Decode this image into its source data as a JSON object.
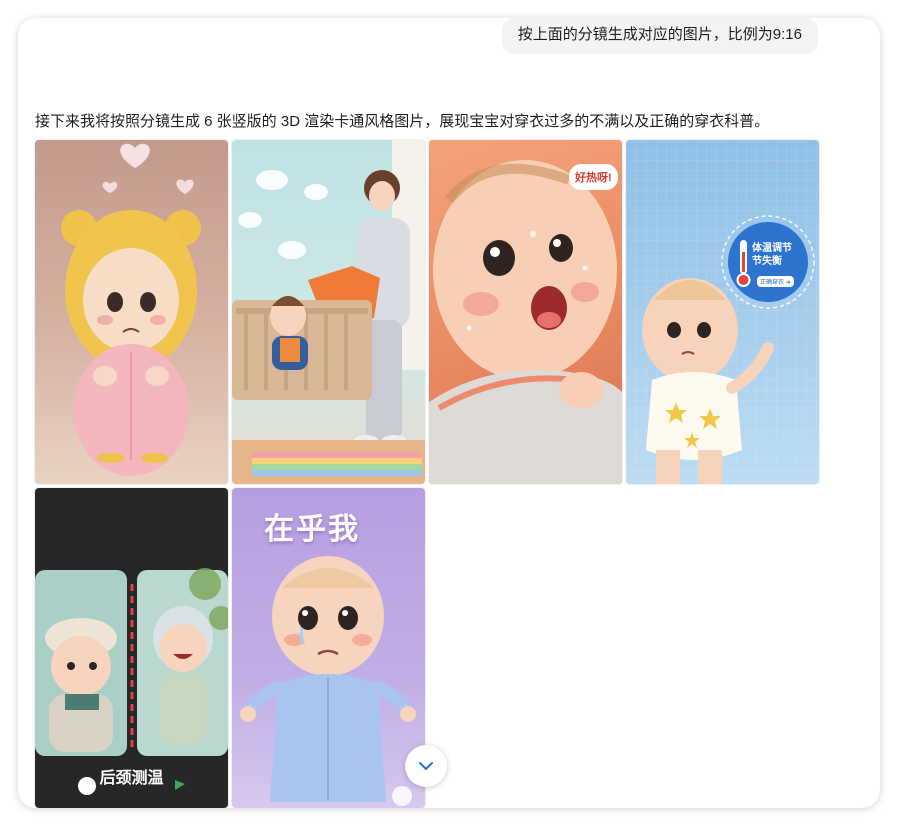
{
  "conversation": {
    "user_message": "按上面的分镜生成对应的图片，比例为9:16",
    "assistant_message": "接下来我将按照分镜生成 6 张竖版的 3D 渲染卡通风格图片，展现宝宝对穿衣过多的不满以及正确的穿衣科普。"
  },
  "images": {
    "image3_speech": "好热呀!",
    "image4_badge_line1": "体温调节",
    "image4_badge_line2": "节失衡",
    "image4_badge_button": "正确穿衣 ➜",
    "image5_caption": "后颈测温",
    "image6_headline": "在乎我"
  },
  "icons": {
    "scroll_down": "chevron-down-icon"
  },
  "colors": {
    "accent_blue": "#2a6ad8",
    "bubble_bg": "#f3f3f5"
  }
}
